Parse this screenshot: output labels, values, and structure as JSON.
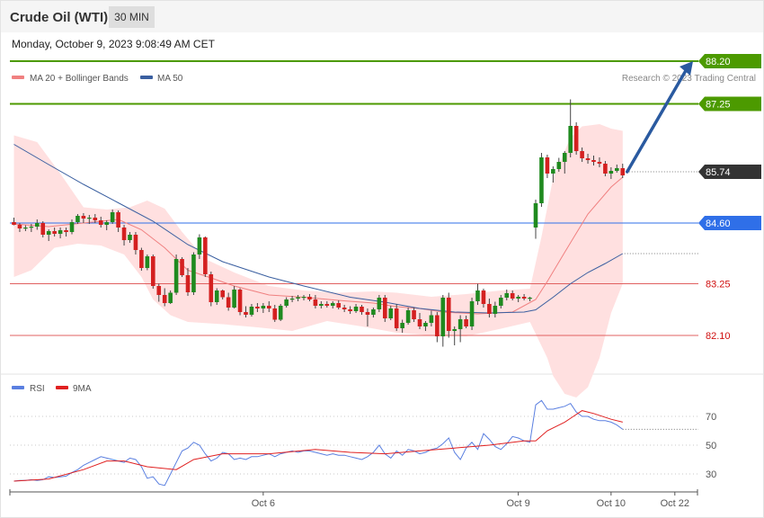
{
  "header": {
    "title": "Crude Oil (WTI)",
    "timeframe": "30 MIN",
    "datetime": "Monday, October 9, 2023 9:08:49 AM CET"
  },
  "legend": [
    {
      "label": "MA 20 + Bollinger Bands",
      "color": "#f08080"
    },
    {
      "label": "MA 50",
      "color": "#3a5fa0"
    }
  ],
  "credit": "Research © 2023 Trading Central",
  "colors": {
    "resistance": "#4c9a00",
    "pivot": "#2f6fe8",
    "support": "#e06060",
    "support_text": "#d01010",
    "price_tag": "#333333",
    "bull_candle": "#1f8a1f",
    "bear_candle": "#d42020",
    "bb_fill": "#ffe0e0",
    "ma20": "#f08080",
    "ma50": "#3a5fa0",
    "arrow": "#2a5aa0",
    "rsi": "#5a7fe0",
    "rsi_ma": "#e02020"
  },
  "chart_data": [
    {
      "type": "candlestick",
      "series_name": "Crude Oil (WTI) 30 MIN",
      "ylim": [
        80.0,
        88.4
      ],
      "levels": [
        {
          "value": 88.2,
          "label": "88.20",
          "kind": "resistance"
        },
        {
          "value": 87.25,
          "label": "87.25",
          "kind": "resistance"
        },
        {
          "value": 85.74,
          "label": "85.74",
          "kind": "last_price"
        },
        {
          "value": 84.6,
          "label": "84.60",
          "kind": "pivot"
        },
        {
          "value": 83.25,
          "label": "83.25",
          "kind": "support"
        },
        {
          "value": 82.1,
          "label": "82.10",
          "kind": "support"
        }
      ],
      "ohlc": [
        [
          84.62,
          84.72,
          84.55,
          84.56
        ],
        [
          84.56,
          84.6,
          84.4,
          84.48
        ],
        [
          84.48,
          84.55,
          84.42,
          84.5
        ],
        [
          84.5,
          84.58,
          84.4,
          84.52
        ],
        [
          84.52,
          84.68,
          84.45,
          84.6
        ],
        [
          84.6,
          84.64,
          84.28,
          84.34
        ],
        [
          84.34,
          84.46,
          84.2,
          84.42
        ],
        [
          84.42,
          84.5,
          84.3,
          84.36
        ],
        [
          84.36,
          84.5,
          84.26,
          84.44
        ],
        [
          84.44,
          84.5,
          84.3,
          84.4
        ],
        [
          84.4,
          84.68,
          84.35,
          84.62
        ],
        [
          84.62,
          84.8,
          84.58,
          84.76
        ],
        [
          84.76,
          84.82,
          84.6,
          84.7
        ],
        [
          84.7,
          84.78,
          84.58,
          84.72
        ],
        [
          84.72,
          84.8,
          84.6,
          84.66
        ],
        [
          84.66,
          84.74,
          84.5,
          84.56
        ],
        [
          84.56,
          84.66,
          84.44,
          84.62
        ],
        [
          84.62,
          84.9,
          84.58,
          84.84
        ],
        [
          84.84,
          84.88,
          84.4,
          84.5
        ],
        [
          84.5,
          84.56,
          84.1,
          84.22
        ],
        [
          84.22,
          84.4,
          84.16,
          84.34
        ],
        [
          84.34,
          84.4,
          83.9,
          84.0
        ],
        [
          84.0,
          84.05,
          83.54,
          83.6
        ],
        [
          83.6,
          83.9,
          83.55,
          83.86
        ],
        [
          83.86,
          83.9,
          83.14,
          83.2
        ],
        [
          83.2,
          83.25,
          82.85,
          83.0
        ],
        [
          83.0,
          83.15,
          82.75,
          82.82
        ],
        [
          82.82,
          83.1,
          82.8,
          83.05
        ],
        [
          83.05,
          83.9,
          83.0,
          83.8
        ],
        [
          83.8,
          83.84,
          83.4,
          83.44
        ],
        [
          83.44,
          83.6,
          82.98,
          83.06
        ],
        [
          83.06,
          83.95,
          83.0,
          83.9
        ],
        [
          83.9,
          84.35,
          83.8,
          84.28
        ],
        [
          84.28,
          84.3,
          83.4,
          83.46
        ],
        [
          83.46,
          83.52,
          82.75,
          82.84
        ],
        [
          82.84,
          83.15,
          82.78,
          83.1
        ],
        [
          83.1,
          83.12,
          82.9,
          82.95
        ],
        [
          82.95,
          83.05,
          82.65,
          82.72
        ],
        [
          82.72,
          83.2,
          82.7,
          83.12
        ],
        [
          83.12,
          83.15,
          82.55,
          82.62
        ],
        [
          82.62,
          82.75,
          82.5,
          82.56
        ],
        [
          82.56,
          82.8,
          82.52,
          82.74
        ],
        [
          82.74,
          82.82,
          82.62,
          82.7
        ],
        [
          82.7,
          82.82,
          82.6,
          82.76
        ],
        [
          82.76,
          82.86,
          82.62,
          82.7
        ],
        [
          82.7,
          82.78,
          82.4,
          82.45
        ],
        [
          82.45,
          82.8,
          82.42,
          82.76
        ],
        [
          82.76,
          82.95,
          82.72,
          82.9
        ],
        [
          82.9,
          82.98,
          82.84,
          82.92
        ],
        [
          82.92,
          83.0,
          82.86,
          82.95
        ],
        [
          82.95,
          83.0,
          82.88,
          82.96
        ],
        [
          82.96,
          83.02,
          82.86,
          82.9
        ],
        [
          82.9,
          83.0,
          82.7,
          82.76
        ],
        [
          82.76,
          82.86,
          82.7,
          82.8
        ],
        [
          82.8,
          82.86,
          82.72,
          82.76
        ],
        [
          82.76,
          82.86,
          82.7,
          82.82
        ],
        [
          82.82,
          82.88,
          82.68,
          82.72
        ],
        [
          82.72,
          82.78,
          82.62,
          82.68
        ],
        [
          82.68,
          82.75,
          82.58,
          82.64
        ],
        [
          82.64,
          82.8,
          82.6,
          82.74
        ],
        [
          82.74,
          82.78,
          82.56,
          82.62
        ],
        [
          82.62,
          82.7,
          82.3,
          82.56
        ],
        [
          82.56,
          82.72,
          82.5,
          82.68
        ],
        [
          82.68,
          83.0,
          82.62,
          82.94
        ],
        [
          82.94,
          83.0,
          82.4,
          82.48
        ],
        [
          82.48,
          82.76,
          82.44,
          82.7
        ],
        [
          82.7,
          82.8,
          82.2,
          82.26
        ],
        [
          82.26,
          82.45,
          82.16,
          82.38
        ],
        [
          82.38,
          82.72,
          82.34,
          82.66
        ],
        [
          82.66,
          82.72,
          82.4,
          82.46
        ],
        [
          82.46,
          82.6,
          82.24,
          82.3
        ],
        [
          82.3,
          82.42,
          82.2,
          82.38
        ],
        [
          82.38,
          82.65,
          82.3,
          82.55
        ],
        [
          82.55,
          82.62,
          81.95,
          82.08
        ],
        [
          82.08,
          83.0,
          81.85,
          82.94
        ],
        [
          82.94,
          83.05,
          82.05,
          82.2
        ],
        [
          82.2,
          82.3,
          81.88,
          82.24
        ],
        [
          82.24,
          82.55,
          81.95,
          82.46
        ],
        [
          82.46,
          82.54,
          82.26,
          82.3
        ],
        [
          82.3,
          82.94,
          82.22,
          82.86
        ],
        [
          82.86,
          83.25,
          82.78,
          83.1
        ],
        [
          83.1,
          83.14,
          82.72,
          82.8
        ],
        [
          82.8,
          82.92,
          82.5,
          82.58
        ],
        [
          82.58,
          82.85,
          82.5,
          82.76
        ],
        [
          82.76,
          83.0,
          82.7,
          82.94
        ],
        [
          82.94,
          83.12,
          82.88,
          83.04
        ],
        [
          83.04,
          83.1,
          82.88,
          82.92
        ],
        [
          82.92,
          83.0,
          82.84,
          82.96
        ],
        [
          82.96,
          83.02,
          82.88,
          82.92
        ],
        [
          82.92,
          82.96,
          82.86,
          82.94
        ],
        [
          84.5,
          85.12,
          84.25,
          85.04
        ],
        [
          85.04,
          86.16,
          84.96,
          86.06
        ],
        [
          86.06,
          86.12,
          85.6,
          85.7
        ],
        [
          85.7,
          85.86,
          85.5,
          85.8
        ],
        [
          85.8,
          86.05,
          85.74,
          85.96
        ],
        [
          85.96,
          86.2,
          85.7,
          86.16
        ],
        [
          86.16,
          87.35,
          86.06,
          86.76
        ],
        [
          86.76,
          86.84,
          86.12,
          86.2
        ],
        [
          86.2,
          86.28,
          85.96,
          86.04
        ],
        [
          86.04,
          86.14,
          85.92,
          86.0
        ],
        [
          86.0,
          86.1,
          85.88,
          85.96
        ],
        [
          85.96,
          86.06,
          85.84,
          85.92
        ],
        [
          85.92,
          85.98,
          85.64,
          85.7
        ],
        [
          85.7,
          85.84,
          85.58,
          85.76
        ],
        [
          85.76,
          85.9,
          85.72,
          85.82
        ],
        [
          85.82,
          85.92,
          85.6,
          85.66
        ]
      ],
      "ma20_curve": [
        [
          0,
          84.58
        ],
        [
          6,
          84.52
        ],
        [
          12,
          84.6
        ],
        [
          18,
          84.68
        ],
        [
          22,
          84.45
        ],
        [
          26,
          84.05
        ],
        [
          30,
          83.55
        ],
        [
          34,
          83.38
        ],
        [
          38,
          83.2
        ],
        [
          44,
          83.0
        ],
        [
          50,
          82.95
        ],
        [
          56,
          82.88
        ],
        [
          62,
          82.82
        ],
        [
          66,
          82.74
        ],
        [
          70,
          82.7
        ],
        [
          74,
          82.62
        ],
        [
          80,
          82.58
        ],
        [
          86,
          82.62
        ],
        [
          90,
          82.9
        ],
        [
          92,
          83.3
        ],
        [
          95,
          83.95
        ],
        [
          99,
          84.8
        ],
        [
          103,
          85.4
        ],
        [
          105,
          85.62
        ]
      ],
      "bb_upper": [
        [
          0,
          86.55
        ],
        [
          4,
          86.4
        ],
        [
          8,
          85.7
        ],
        [
          12,
          84.95
        ],
        [
          16,
          84.9
        ],
        [
          20,
          84.95
        ],
        [
          23,
          85.1
        ],
        [
          26,
          84.92
        ],
        [
          29,
          84.4
        ],
        [
          33,
          83.8
        ],
        [
          38,
          83.5
        ],
        [
          44,
          83.2
        ],
        [
          50,
          83.1
        ],
        [
          56,
          83.05
        ],
        [
          62,
          83.08
        ],
        [
          66,
          83.05
        ],
        [
          72,
          82.96
        ],
        [
          78,
          83.02
        ],
        [
          84,
          83.1
        ],
        [
          89,
          83.14
        ],
        [
          91,
          84.3
        ],
        [
          93,
          85.6
        ],
        [
          96,
          86.5
        ],
        [
          98,
          86.75
        ],
        [
          101,
          86.8
        ],
        [
          103,
          86.7
        ],
        [
          105,
          86.65
        ]
      ],
      "bb_lower": [
        [
          105,
          83.25
        ],
        [
          103,
          82.6
        ],
        [
          101,
          81.6
        ],
        [
          99,
          80.95
        ],
        [
          97,
          80.72
        ],
        [
          95,
          80.8
        ],
        [
          93,
          81.2
        ],
        [
          92,
          81.6
        ],
        [
          89,
          82.4
        ],
        [
          84,
          82.25
        ],
        [
          78,
          82.08
        ],
        [
          72,
          82.1
        ],
        [
          66,
          82.16
        ],
        [
          60,
          82.3
        ],
        [
          54,
          82.42
        ],
        [
          48,
          82.2
        ],
        [
          42,
          82.28
        ],
        [
          36,
          82.35
        ],
        [
          30,
          82.4
        ],
        [
          27,
          82.55
        ],
        [
          24,
          82.9
        ],
        [
          22,
          83.4
        ],
        [
          19,
          83.9
        ],
        [
          15,
          84.1
        ],
        [
          11,
          84.14
        ],
        [
          7,
          84.05
        ],
        [
          3,
          83.55
        ],
        [
          0,
          83.4
        ]
      ],
      "ma50_curve": [
        [
          0,
          86.35
        ],
        [
          6,
          85.9
        ],
        [
          12,
          85.46
        ],
        [
          18,
          85.05
        ],
        [
          24,
          84.64
        ],
        [
          30,
          84.12
        ],
        [
          36,
          83.74
        ],
        [
          44,
          83.4
        ],
        [
          50,
          83.2
        ],
        [
          58,
          82.95
        ],
        [
          64,
          82.84
        ],
        [
          70,
          82.7
        ],
        [
          76,
          82.62
        ],
        [
          82,
          82.6
        ],
        [
          88,
          82.62
        ],
        [
          90,
          82.67
        ],
        [
          93,
          82.95
        ],
        [
          96,
          83.25
        ],
        [
          99,
          83.5
        ],
        [
          102,
          83.7
        ],
        [
          105,
          83.92
        ]
      ],
      "projection_arrow": {
        "from_value": 85.74,
        "to_value": 88.2
      }
    },
    {
      "type": "line",
      "series": [
        {
          "name": "RSI"
        },
        {
          "name": "9MA"
        }
      ],
      "ylim": [
        18,
        88
      ],
      "levels": [
        {
          "value": 70,
          "label": "70"
        },
        {
          "value": 50,
          "label": "50"
        },
        {
          "value": 30,
          "label": "30"
        }
      ],
      "rsi": [
        25,
        25.5,
        25.5,
        26,
        25.5,
        26,
        28,
        27.5,
        28,
        28.5,
        31,
        33,
        36,
        38,
        40,
        42,
        41,
        40,
        39,
        38,
        41,
        40,
        35,
        27,
        28,
        23,
        22,
        30,
        38,
        46,
        48,
        52,
        50,
        44,
        39,
        41,
        45,
        44,
        40,
        41,
        40,
        42,
        42,
        43,
        44,
        42,
        44,
        45,
        46,
        45,
        46,
        46,
        45,
        44,
        43,
        44,
        43,
        43,
        42,
        41,
        40,
        42,
        45,
        50,
        44,
        41,
        46,
        43,
        47,
        46,
        44,
        45,
        47,
        48,
        51,
        55,
        45,
        40,
        48,
        52,
        47,
        58,
        54,
        49,
        47,
        51,
        56,
        55,
        53,
        52,
        78,
        81,
        75,
        75,
        76,
        77,
        79,
        73,
        70,
        70,
        68,
        67,
        67,
        66,
        64,
        61
      ],
      "rsi_ma": [
        [
          0,
          25
        ],
        [
          6,
          26.5
        ],
        [
          12,
          33
        ],
        [
          16,
          39
        ],
        [
          19,
          39
        ],
        [
          23,
          35
        ],
        [
          28,
          33
        ],
        [
          31,
          40
        ],
        [
          36,
          44
        ],
        [
          44,
          44
        ],
        [
          52,
          47
        ],
        [
          58,
          45
        ],
        [
          64,
          44
        ],
        [
          70,
          46
        ],
        [
          76,
          48
        ],
        [
          82,
          50
        ],
        [
          88,
          53
        ],
        [
          90,
          53
        ],
        [
          92,
          60
        ],
        [
          95,
          66
        ],
        [
          98,
          74
        ],
        [
          100,
          72
        ],
        [
          103,
          68
        ],
        [
          105,
          66
        ]
      ]
    }
  ],
  "x_axis": {
    "ticks": [
      {
        "label": "Oct 6",
        "index": 43
      },
      {
        "label": "Oct 9",
        "index": 87
      },
      {
        "label": "Oct 10",
        "index": 103
      },
      {
        "label": "Oct 22",
        "index": 114
      }
    ]
  }
}
